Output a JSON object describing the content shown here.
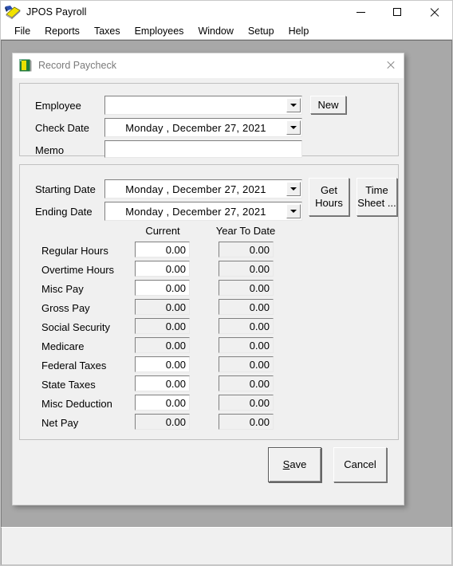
{
  "app": {
    "title": "JPOS Payroll",
    "icon": "payroll-app-icon",
    "window_controls": {
      "minimize": "minimize-icon",
      "maximize": "maximize-icon",
      "close": "close-icon"
    },
    "menu": [
      {
        "label": "File"
      },
      {
        "label": "Reports"
      },
      {
        "label": "Taxes"
      },
      {
        "label": "Employees"
      },
      {
        "label": "Window"
      },
      {
        "label": "Setup"
      },
      {
        "label": "Help"
      }
    ]
  },
  "dialog": {
    "title": "Record Paycheck",
    "icon": "jpos-document-icon",
    "close_icon": "close-icon",
    "header_group": {
      "employee": {
        "label": "Employee",
        "value": "",
        "dropdown_icon": "chevron-down-icon"
      },
      "check_date": {
        "label": "Check Date",
        "value": "Monday    , December 27, 2021",
        "dropdown_icon": "chevron-down-icon"
      },
      "memo": {
        "label": "Memo",
        "value": "",
        "placeholder": ""
      },
      "new_button": "New"
    },
    "period_group": {
      "starting_date": {
        "label": "Starting Date",
        "value": "Monday    , December 27, 2021",
        "dropdown_icon": "chevron-down-icon"
      },
      "ending_date": {
        "label": "Ending Date",
        "value": "Monday    , December 27, 2021",
        "dropdown_icon": "chevron-down-icon"
      },
      "get_hours_button": {
        "line1": "Get",
        "line2": "Hours"
      },
      "time_sheet_button": {
        "line1": "Time",
        "line2": "Sheet ..."
      }
    },
    "amounts": {
      "column_headers": [
        "Current",
        "Year To Date"
      ],
      "rows": [
        {
          "label": "Regular Hours",
          "current": "0.00",
          "ytd": "0.00",
          "current_editable": true
        },
        {
          "label": "Overtime Hours",
          "current": "0.00",
          "ytd": "0.00",
          "current_editable": true
        },
        {
          "label": "Misc Pay",
          "current": "0.00",
          "ytd": "0.00",
          "current_editable": true
        },
        {
          "label": "Gross Pay",
          "current": "0.00",
          "ytd": "0.00",
          "current_editable": false
        },
        {
          "label": "Social Security",
          "current": "0.00",
          "ytd": "0.00",
          "current_editable": false
        },
        {
          "label": "Medicare",
          "current": "0.00",
          "ytd": "0.00",
          "current_editable": false
        },
        {
          "label": "Federal Taxes",
          "current": "0.00",
          "ytd": "0.00",
          "current_editable": true
        },
        {
          "label": "State Taxes",
          "current": "0.00",
          "ytd": "0.00",
          "current_editable": true
        },
        {
          "label": "Misc Deduction",
          "current": "0.00",
          "ytd": "0.00",
          "current_editable": true
        },
        {
          "label": "Net Pay",
          "current": "0.00",
          "ytd": "0.00",
          "current_editable": false
        }
      ]
    },
    "actions": {
      "save": {
        "accel": "S",
        "rest": "ave",
        "full": "Save",
        "is_default": true
      },
      "cancel": {
        "full": "Cancel",
        "is_default": false
      }
    }
  },
  "colors": {
    "mdi_background": "#a8a8a8",
    "dialog_face": "#f0f0f0",
    "field_background": "#ffffff",
    "readonly_field": "#f0f0f0",
    "title_text": "#7a7a7a",
    "icon_green": "#1f7a3d",
    "icon_yellow": "#e8e000"
  }
}
